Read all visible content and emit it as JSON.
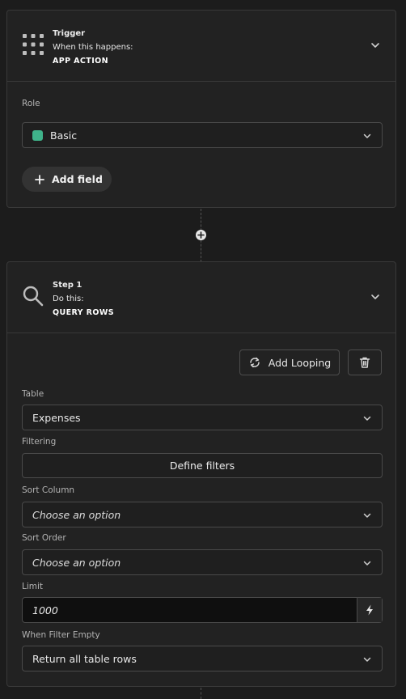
{
  "trigger": {
    "title": "Trigger",
    "subtitle": "When this happens:",
    "action": "APP ACTION",
    "role_label": "Role",
    "role_value": "Basic",
    "role_color": "#3fb38a",
    "add_field_label": "Add field"
  },
  "step": {
    "title": "Step 1",
    "subtitle": "Do this:",
    "action": "QUERY ROWS",
    "add_looping_label": "Add Looping",
    "fields": {
      "table_label": "Table",
      "table_value": "Expenses",
      "filtering_label": "Filtering",
      "define_filters_label": "Define filters",
      "sort_column_label": "Sort Column",
      "sort_column_value": "Choose an option",
      "sort_order_label": "Sort Order",
      "sort_order_value": "Choose an option",
      "limit_label": "Limit",
      "limit_value": "1000",
      "when_filter_empty_label": "When Filter Empty",
      "when_filter_empty_value": "Return all table rows"
    }
  },
  "icons": {
    "trigger": "grid-dots-icon",
    "step": "search-icon",
    "expand": "chevron-down-icon",
    "add": "plus-icon",
    "add_step": "plus-circle-icon",
    "looping": "loop-icon",
    "delete": "trash-icon",
    "binding": "lightning-icon"
  }
}
